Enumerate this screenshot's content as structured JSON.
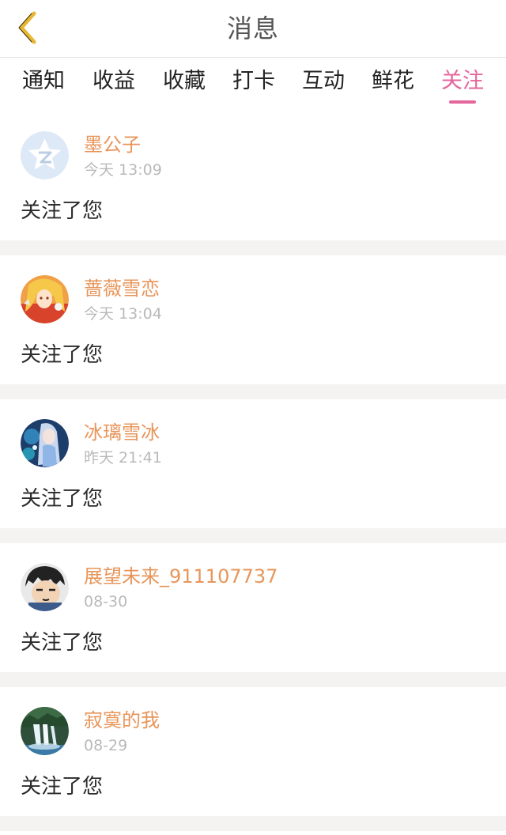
{
  "header": {
    "title": "消息",
    "back_icon": "chevron-left-icon",
    "back_color": "#e8b833"
  },
  "tabs": [
    {
      "label": "通知",
      "active": false
    },
    {
      "label": "收益",
      "active": false
    },
    {
      "label": "收藏",
      "active": false
    },
    {
      "label": "打卡",
      "active": false
    },
    {
      "label": "互动",
      "active": false
    },
    {
      "label": "鲜花",
      "active": false
    },
    {
      "label": "关注",
      "active": true
    }
  ],
  "colors": {
    "accent": "#e5669c",
    "username": "#e8955a",
    "timestamp": "#b9b9b9",
    "divider": "#f5f2f2"
  },
  "notifications": [
    {
      "name": "墨公子",
      "time": "今天 13:09",
      "message": "关注了您",
      "avatar": "default-qq-avatar"
    },
    {
      "name": "蔷薇雪恋",
      "time": "今天 13:04",
      "message": "关注了您",
      "avatar": "anime-girl-avatar"
    },
    {
      "name": "冰璃雪冰",
      "time": "昨天 21:41",
      "message": "关注了您",
      "avatar": "fantasy-girl-avatar"
    },
    {
      "name": "展望未来_911107737",
      "time": "08-30",
      "message": "关注了您",
      "avatar": "cartoon-boy-avatar"
    },
    {
      "name": "寂寞的我",
      "time": "08-29",
      "message": "关注了您",
      "avatar": "waterfall-avatar"
    }
  ]
}
